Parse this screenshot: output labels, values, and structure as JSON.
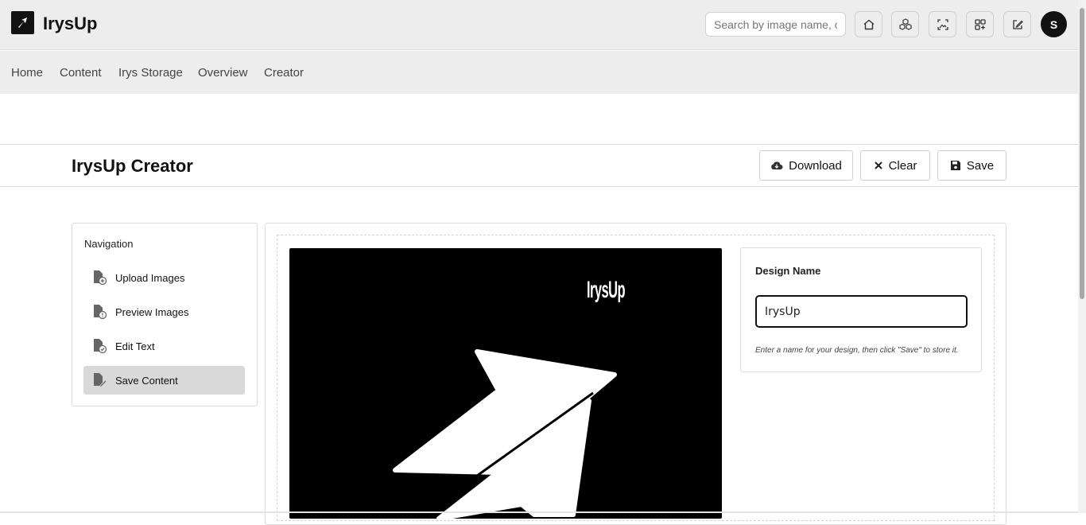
{
  "app": {
    "name": "IrysUp"
  },
  "search": {
    "placeholder": "Search by image name, creator"
  },
  "user": {
    "avatar_initial": "S"
  },
  "header_icons": [
    "home-icon",
    "cubes-icon",
    "image-scan-icon",
    "apps-add-icon",
    "edit-icon"
  ],
  "nav": {
    "links": [
      "Home",
      "Content",
      "Irys Storage",
      "Overview",
      "Creator"
    ]
  },
  "page": {
    "title": "IrysUp Creator"
  },
  "actions": {
    "download_label": "Download",
    "clear_label": "Clear",
    "save_label": "Save"
  },
  "sidebar": {
    "title": "Navigation",
    "items": [
      {
        "label": "Upload Images",
        "icon": "file-plus-icon",
        "active": false
      },
      {
        "label": "Preview Images",
        "icon": "file-alert-icon",
        "active": false
      },
      {
        "label": "Edit Text",
        "icon": "file-check-icon",
        "active": false
      },
      {
        "label": "Save Content",
        "icon": "file-edit-icon",
        "active": true
      }
    ]
  },
  "canvas": {
    "brand_text": "IrysUp"
  },
  "design": {
    "label": "Design Name",
    "value": "IrysUp",
    "hint": "Enter a name for your design, then click \"Save\" to store it."
  }
}
